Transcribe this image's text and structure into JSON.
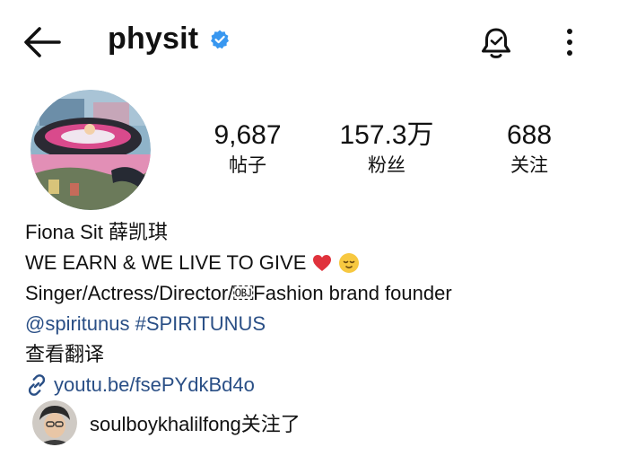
{
  "header": {
    "username": "physit",
    "back_icon": "arrow-left-icon",
    "verified_icon": "verified-badge-icon",
    "verified_color": "#3897f0",
    "notification_icon": "bell-icon",
    "more_icon": "more-vertical-icon"
  },
  "profile": {
    "avatar_icon": "profile-avatar-image",
    "stats": [
      {
        "value": "9,687",
        "label": "帖子"
      },
      {
        "value": "157.3万",
        "label": "粉丝"
      },
      {
        "value": "688",
        "label": "关注"
      }
    ]
  },
  "bio": {
    "name": "Fiona Sit 薛凯琪",
    "tagline": "WE EARN & WE LIVE TO GIVE",
    "tagline_emojis": [
      "red-heart-emoji",
      "relieved-face-emoji"
    ],
    "description": "Singer/Actress/Director/￼Fashion brand founder",
    "tags": "@spiritunus #SPIRITUNUS",
    "translate_label": "查看翻译",
    "url": "youtu.be/fsePYdkBd4o",
    "link_color": "#2a4f86"
  },
  "followed_by": {
    "avatar_icon": "follower-avatar-image",
    "text": "soulboykhalilfong关注了"
  }
}
